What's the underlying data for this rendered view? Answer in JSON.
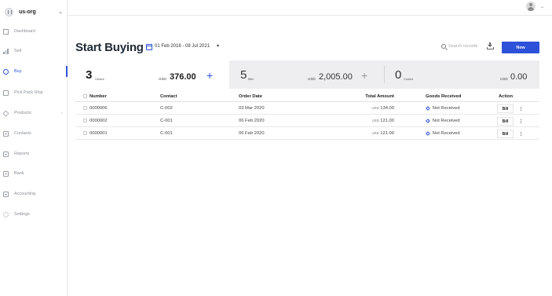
{
  "sidebar": {
    "org_name": "us-org",
    "org_chevron": "⌄",
    "items": [
      {
        "label": "Dashboard",
        "icon": "dashboard-icon"
      },
      {
        "label": "Sell",
        "icon": "bar-chart-icon"
      },
      {
        "label": "Buy",
        "icon": "circle-icon",
        "active": true
      },
      {
        "label": "Pick Pack Ship",
        "icon": "truck-icon"
      },
      {
        "label": "Products",
        "icon": "gem-icon",
        "chevron": "›"
      },
      {
        "label": "Contacts",
        "icon": "contacts-icon"
      },
      {
        "label": "Reports",
        "icon": "reports-icon"
      },
      {
        "label": "Bank",
        "icon": "bank-icon"
      },
      {
        "label": "Accounting",
        "icon": "accounting-icon"
      },
      {
        "label": "Settings",
        "icon": "gear-icon"
      }
    ]
  },
  "topbar": {
    "user_chevron": "⌄"
  },
  "header": {
    "title": "Start Buying",
    "date_range": "01 Feb 2016 - 08 Jul 2021",
    "date_caret": "▾",
    "search_placeholder": "Search records",
    "new_label": "New"
  },
  "summary": {
    "orders_count": "3",
    "orders_label": "Orders",
    "orders_currency": "USD",
    "orders_amount": "376.00",
    "bills_count": "5",
    "bills_label": "Bills",
    "bills_currency": "USD",
    "bills_amount": "2,005.00",
    "closed_count": "0",
    "closed_label": "Closed",
    "closed_currency": "USD",
    "closed_amount": "0.00",
    "plus": "+"
  },
  "table": {
    "headers": {
      "number": "Number",
      "contact": "Contact",
      "order_date": "Order Date",
      "total_amount": "Total Amount",
      "goods_received": "Goods Received",
      "action": "Action"
    },
    "rows": [
      {
        "number": "0000006",
        "contact": "C-002",
        "date": "03 Mar 2020",
        "currency": "USD",
        "amount": "134.00",
        "goods": "Not Received",
        "action": "Bill"
      },
      {
        "number": "0000002",
        "contact": "C-001",
        "date": "06 Feb 2020",
        "currency": "USD",
        "amount": "121.00",
        "goods": "Not Received",
        "action": "Bill"
      },
      {
        "number": "0000001",
        "contact": "C-001",
        "date": "06 Feb 2020",
        "currency": "USD",
        "amount": "121.00",
        "goods": "Not Received",
        "action": "Bill"
      }
    ]
  },
  "colors": {
    "accent": "#2d51d8",
    "summary_bg": "#eeeef1"
  }
}
